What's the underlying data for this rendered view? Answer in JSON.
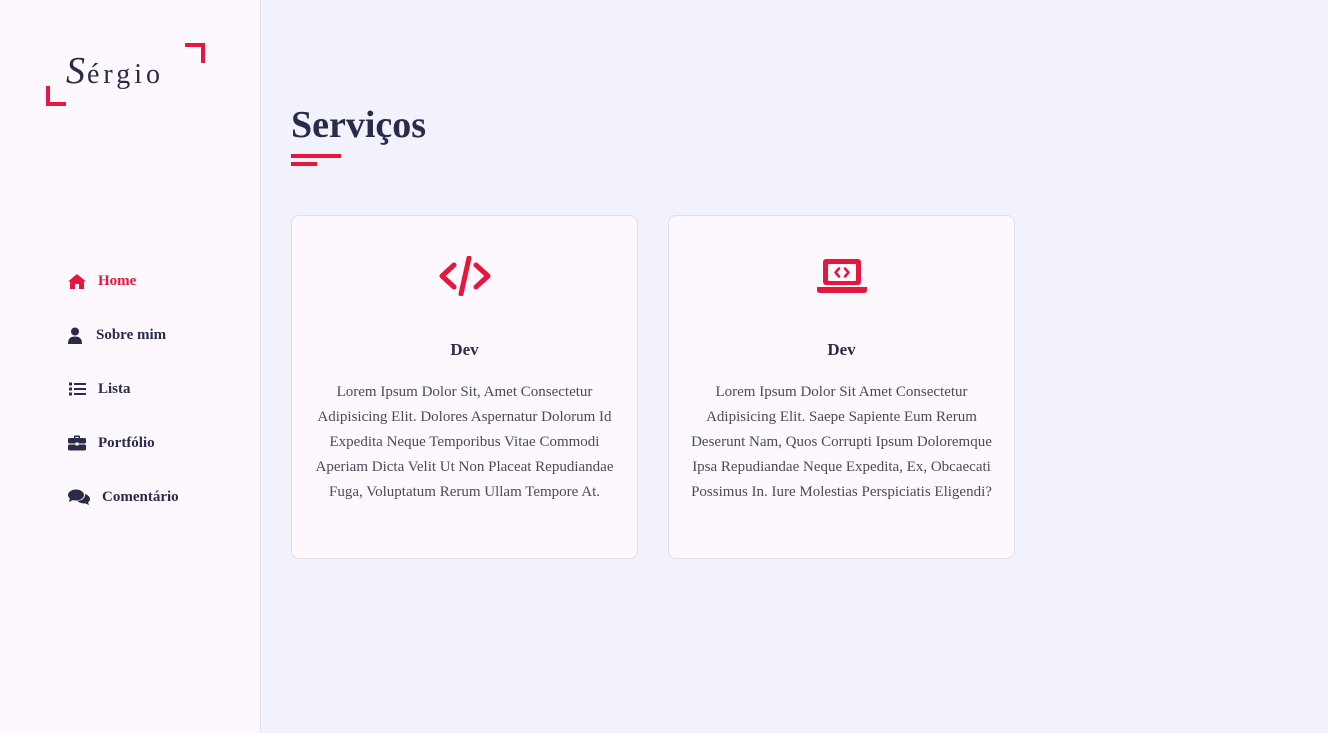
{
  "logo": {
    "first_letter": "S",
    "rest": "érgio"
  },
  "nav": {
    "items": [
      {
        "label": "Home",
        "icon": "home-icon",
        "active": true
      },
      {
        "label": "Sobre mim",
        "icon": "user-icon",
        "active": false
      },
      {
        "label": "Lista",
        "icon": "list-icon",
        "active": false
      },
      {
        "label": "Portfólio",
        "icon": "briefcase-icon",
        "active": false
      },
      {
        "label": "Comentário",
        "icon": "comments-icon",
        "active": false
      }
    ]
  },
  "main": {
    "title": "Serviços",
    "cards": [
      {
        "icon": "code-icon",
        "title": "Dev",
        "text": "Lorem Ipsum Dolor Sit, Amet Consectetur Adipisicing Elit. Dolores Aspernatur Dolorum Id Expedita Neque Temporibus Vitae Commodi Aperiam Dicta Velit Ut Non Placeat Repudiandae Fuga, Voluptatum Rerum Ullam Tempore At."
      },
      {
        "icon": "laptop-code-icon",
        "title": "Dev",
        "text": "Lorem Ipsum Dolor Sit Amet Consectetur Adipisicing Elit. Saepe Sapiente Eum Rerum Deserunt Nam, Quos Corrupti Ipsum Doloremque Ipsa Repudiandae Neque Expedita, Ex, Obcaecati Possimus In. Iure Molestias Perspiciatis Eligendi?"
      }
    ]
  },
  "colors": {
    "accent": "#e5173f",
    "text": "#2a2b4a",
    "sidebar_bg": "#fcf8fd",
    "page_bg": "#f1f2fb"
  }
}
